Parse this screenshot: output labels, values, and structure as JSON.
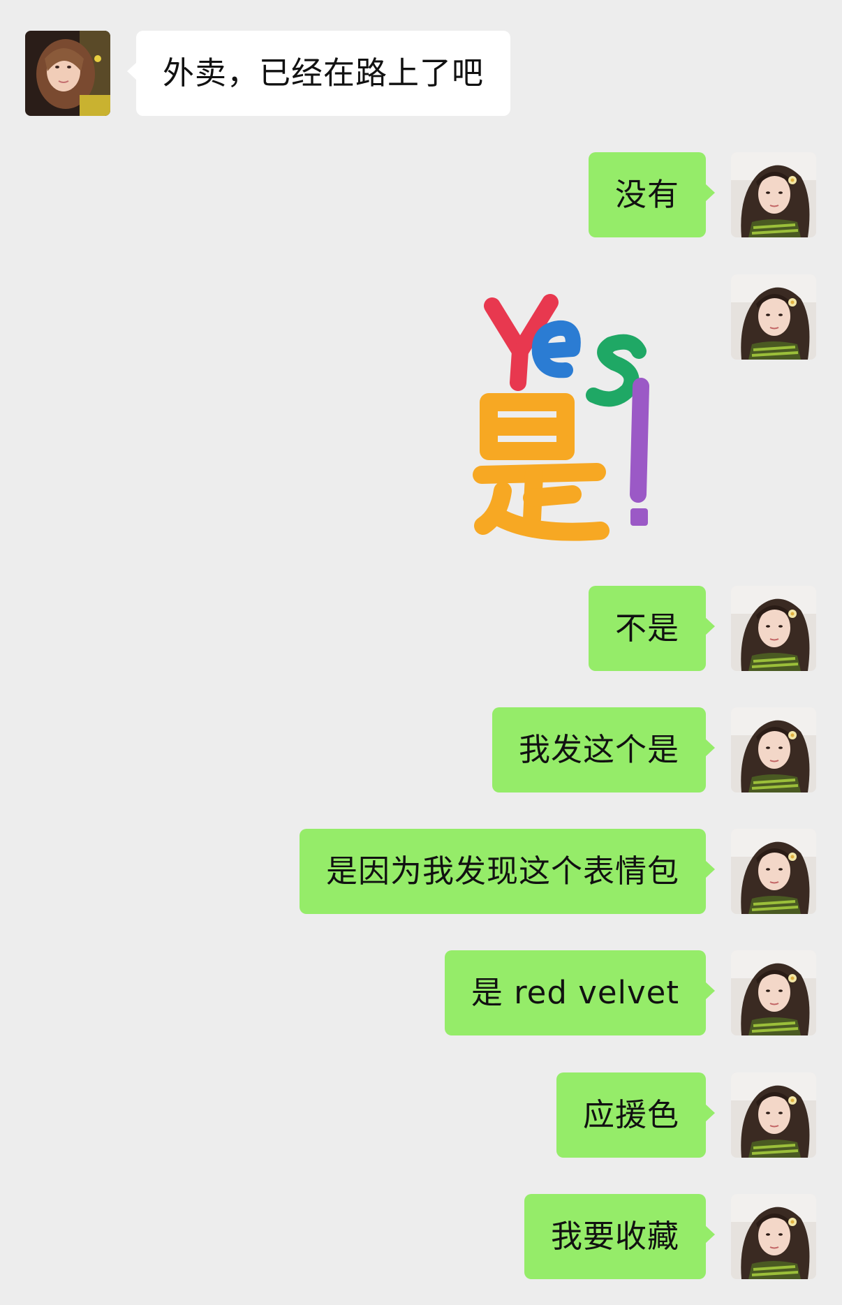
{
  "chat": {
    "messages": [
      {
        "from": "other",
        "text": "外卖，已经在路上了吧"
      },
      {
        "from": "me",
        "text": "没有"
      },
      {
        "from": "me",
        "sticker": {
          "word_en": "Yes",
          "word_cn": "是",
          "mark": "!"
        }
      },
      {
        "from": "me",
        "text": "不是"
      },
      {
        "from": "me",
        "text": "我发这个是"
      },
      {
        "from": "me",
        "text": "是因为我发现这个表情包"
      },
      {
        "from": "me",
        "text": "是 red velvet"
      },
      {
        "from": "me",
        "text": "应援色"
      },
      {
        "from": "me",
        "text": "我要收藏"
      }
    ]
  },
  "colors": {
    "background": "#ededed",
    "my_bubble": "#95ec69",
    "other_bubble": "#ffffff",
    "sticker_red": "#e8384f",
    "sticker_blue": "#2b7cd3",
    "sticker_green": "#1fa865",
    "sticker_orange": "#f7a823",
    "sticker_purple": "#9b59c6"
  },
  "icons": {
    "my_avatar": "avatar-photo-girl-dark-hair",
    "other_avatar": "avatar-photo-girl-light-hair"
  }
}
